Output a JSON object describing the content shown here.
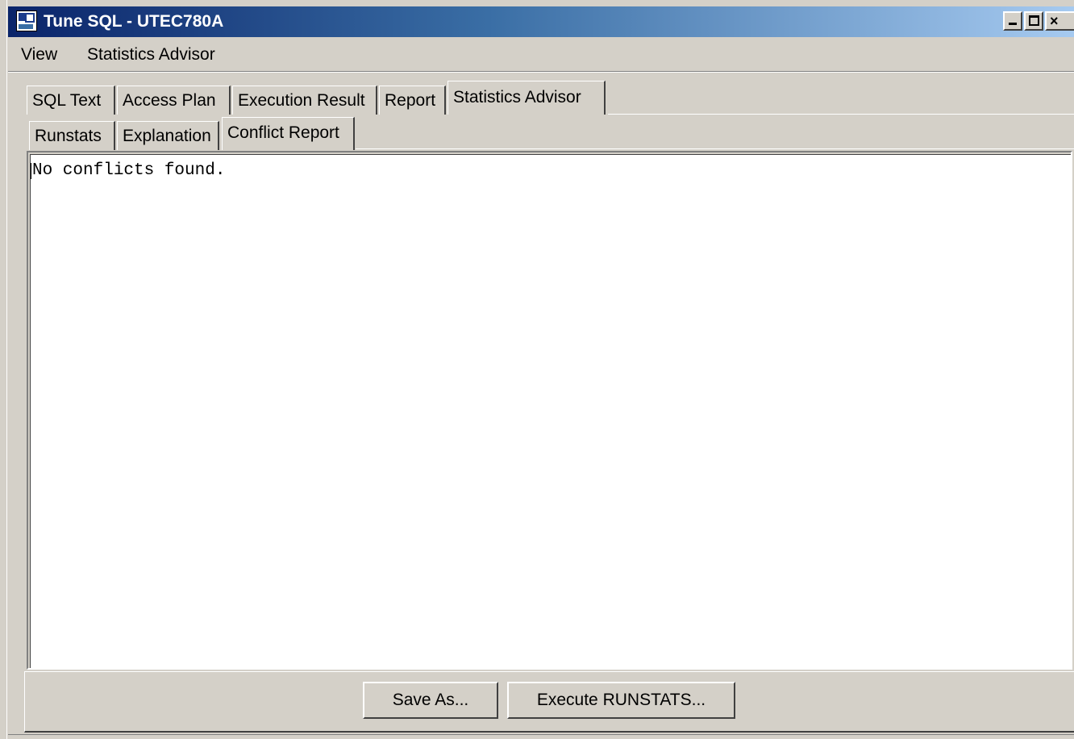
{
  "window": {
    "title": "Tune SQL - UTEC780A",
    "controls": {
      "minimize": "minimize-icon",
      "maximize": "maximize-icon",
      "close": "close-icon"
    }
  },
  "menu": {
    "items": [
      "View",
      "Statistics Advisor"
    ]
  },
  "tabs": {
    "main": [
      "SQL Text",
      "Access Plan",
      "Execution Result",
      "Report",
      "Statistics Advisor"
    ],
    "main_active": "Statistics Advisor",
    "sub": [
      "Runstats",
      "Explanation",
      "Conflict Report"
    ],
    "sub_active": "Conflict Report"
  },
  "content": {
    "text": "No conflicts found."
  },
  "buttons": {
    "save_as": "Save As...",
    "execute_runstats": "Execute RUNSTATS..."
  },
  "colors": {
    "titlebar_start": "#0a246a",
    "titlebar_end": "#a6caf0",
    "face": "#d4d0c8"
  }
}
